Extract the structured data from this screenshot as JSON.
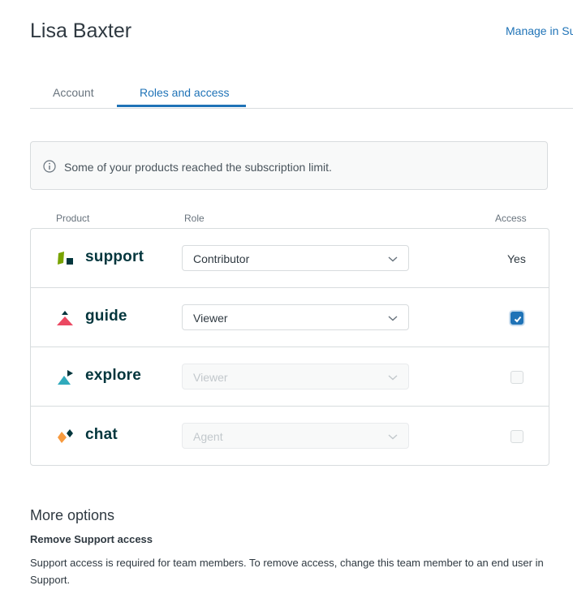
{
  "header": {
    "title": "Lisa Baxter",
    "manage_link": "Manage in Su"
  },
  "tabs": [
    {
      "label": "Account",
      "selected": false
    },
    {
      "label": "Roles and access",
      "selected": true
    }
  ],
  "alert": {
    "icon": "info-icon",
    "text": "Some of your products reached the subscription limit."
  },
  "table": {
    "columns": {
      "product": "Product",
      "role": "Role",
      "access": "Access"
    },
    "rows": [
      {
        "product": "support",
        "logo": "support-logo",
        "role": "Contributor",
        "role_disabled": false,
        "access_text": "Yes"
      },
      {
        "product": "guide",
        "logo": "guide-logo",
        "role": "Viewer",
        "role_disabled": false,
        "access_checked": true
      },
      {
        "product": "explore",
        "logo": "explore-logo",
        "role": "Viewer",
        "role_disabled": true,
        "access_checked": false
      },
      {
        "product": "chat",
        "logo": "chat-logo",
        "role": "Agent",
        "role_disabled": true,
        "access_checked": false
      }
    ]
  },
  "more_options": {
    "title": "More options",
    "remove_title": "Remove Support access",
    "remove_desc": "Support access is required for team members. To remove access, change this team member to an end user in Support."
  },
  "colors": {
    "accent": "#1f73b7",
    "brand_dark": "#03363d",
    "support_green": "#78a300",
    "guide_red": "#eb4962",
    "explore_teal": "#30aabc",
    "chat_orange": "#f79a3e"
  }
}
